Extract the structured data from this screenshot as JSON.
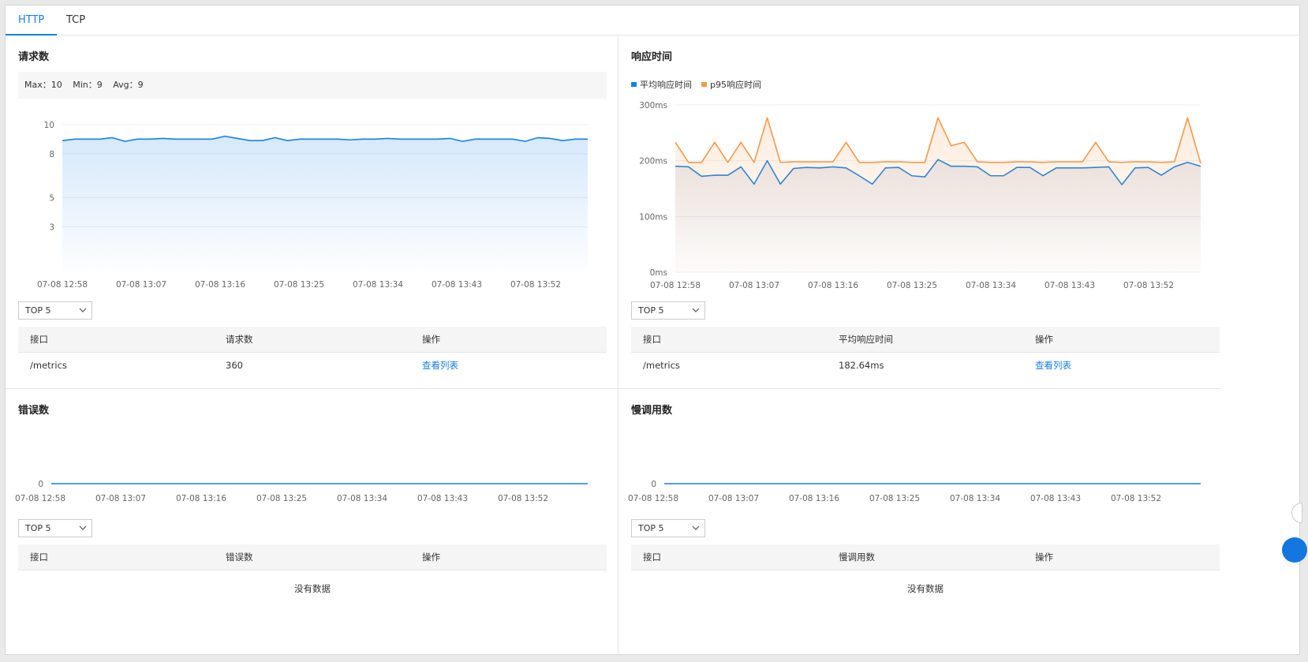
{
  "tabs": [
    {
      "label": "HTTP",
      "active": true
    },
    {
      "label": "TCP",
      "active": false
    }
  ],
  "x_ticks": [
    "07-08 12:58",
    "07-08 13:07",
    "07-08 13:16",
    "07-08 13:25",
    "07-08 13:34",
    "07-08 13:43",
    "07-08 13:52"
  ],
  "panels": {
    "requests": {
      "title": "请求数",
      "stats": {
        "max": "Max：10",
        "min": "Min：9",
        "avg": "Avg：9"
      },
      "select": "TOP 5",
      "columns": [
        "接口",
        "请求数",
        "操作"
      ],
      "rows": [
        {
          "endpoint": "/metrics",
          "value": "360",
          "action": "查看列表"
        }
      ]
    },
    "response": {
      "title": "响应时间",
      "legend": [
        "平均响应时间",
        "p95响应时间"
      ],
      "select": "TOP 5",
      "columns": [
        "接口",
        "平均响应时间",
        "操作"
      ],
      "rows": [
        {
          "endpoint": "/metrics",
          "value": "182.64ms",
          "action": "查看列表"
        }
      ]
    },
    "errors": {
      "title": "错误数",
      "select": "TOP 5",
      "columns": [
        "接口",
        "错误数",
        "操作"
      ],
      "empty": "没有数据"
    },
    "slow": {
      "title": "慢调用数",
      "select": "TOP 5",
      "columns": [
        "接口",
        "慢调用数",
        "操作"
      ],
      "empty": "没有数据"
    }
  },
  "colors": {
    "blue": "#1780e8",
    "orange": "#f59a4a"
  },
  "chart_data": [
    {
      "type": "area",
      "x": [
        "12:58",
        "12:59",
        "13:00",
        "13:01",
        "13:02",
        "13:03",
        "13:04",
        "13:05",
        "13:06",
        "13:07",
        "13:08",
        "13:09",
        "13:10",
        "13:11",
        "13:12",
        "13:13",
        "13:14",
        "13:15",
        "13:16",
        "13:17",
        "13:18",
        "13:19",
        "13:20",
        "13:21",
        "13:22",
        "13:23",
        "13:24",
        "13:25",
        "13:26",
        "13:27",
        "13:28",
        "13:29",
        "13:30",
        "13:31",
        "13:32",
        "13:33",
        "13:34",
        "13:35",
        "13:36",
        "13:37",
        "13:38",
        "13:39",
        "13:40"
      ],
      "series": [
        {
          "values": [
            8.9,
            9.0,
            9.0,
            9.0,
            9.1,
            8.85,
            9.0,
            9.0,
            9.05,
            9.0,
            9.0,
            9.0,
            9.0,
            9.2,
            9.05,
            8.9,
            8.9,
            9.1,
            8.9,
            9.0,
            9.0,
            9.0,
            9.0,
            8.95,
            9.0,
            9.0,
            9.05,
            9.0,
            9.0,
            9.0,
            9.0,
            9.05,
            8.85,
            9.0,
            9.0,
            9.0,
            9.0,
            8.85,
            9.1,
            9.05,
            8.9,
            9.0,
            9.0
          ]
        }
      ],
      "y_ticks": [
        10,
        8,
        5,
        3
      ],
      "ylim": [
        0,
        10.8
      ]
    },
    {
      "type": "area",
      "series": [
        {
          "name": "平均响应时间",
          "values": [
            190,
            189,
            172,
            174,
            174,
            189,
            158,
            200,
            158,
            186,
            188,
            187,
            189,
            187,
            173,
            158,
            187,
            188,
            173,
            171,
            202,
            190,
            190,
            189,
            173,
            173,
            188,
            188,
            173,
            187,
            187,
            187,
            188,
            189,
            157,
            187,
            188,
            174,
            189,
            197,
            190
          ]
        },
        {
          "name": "p95响应时间",
          "values": [
            233,
            197,
            197,
            233,
            197,
            233,
            197,
            277,
            197,
            198,
            198,
            198,
            198,
            233,
            197,
            197,
            198,
            198,
            197,
            197,
            277,
            227,
            233,
            198,
            197,
            197,
            198,
            198,
            197,
            198,
            198,
            198,
            233,
            198,
            197,
            198,
            198,
            197,
            198,
            277,
            195
          ]
        }
      ],
      "y_ticks": [
        "300ms",
        "200ms",
        "100ms",
        "0ms"
      ],
      "ylim": [
        0,
        300
      ]
    },
    {
      "type": "line",
      "series": [
        {
          "values": [
            0,
            0
          ]
        }
      ],
      "y_ticks": [
        "0"
      ]
    },
    {
      "type": "line",
      "series": [
        {
          "values": [
            0,
            0
          ]
        }
      ],
      "y_ticks": [
        "0"
      ]
    }
  ]
}
